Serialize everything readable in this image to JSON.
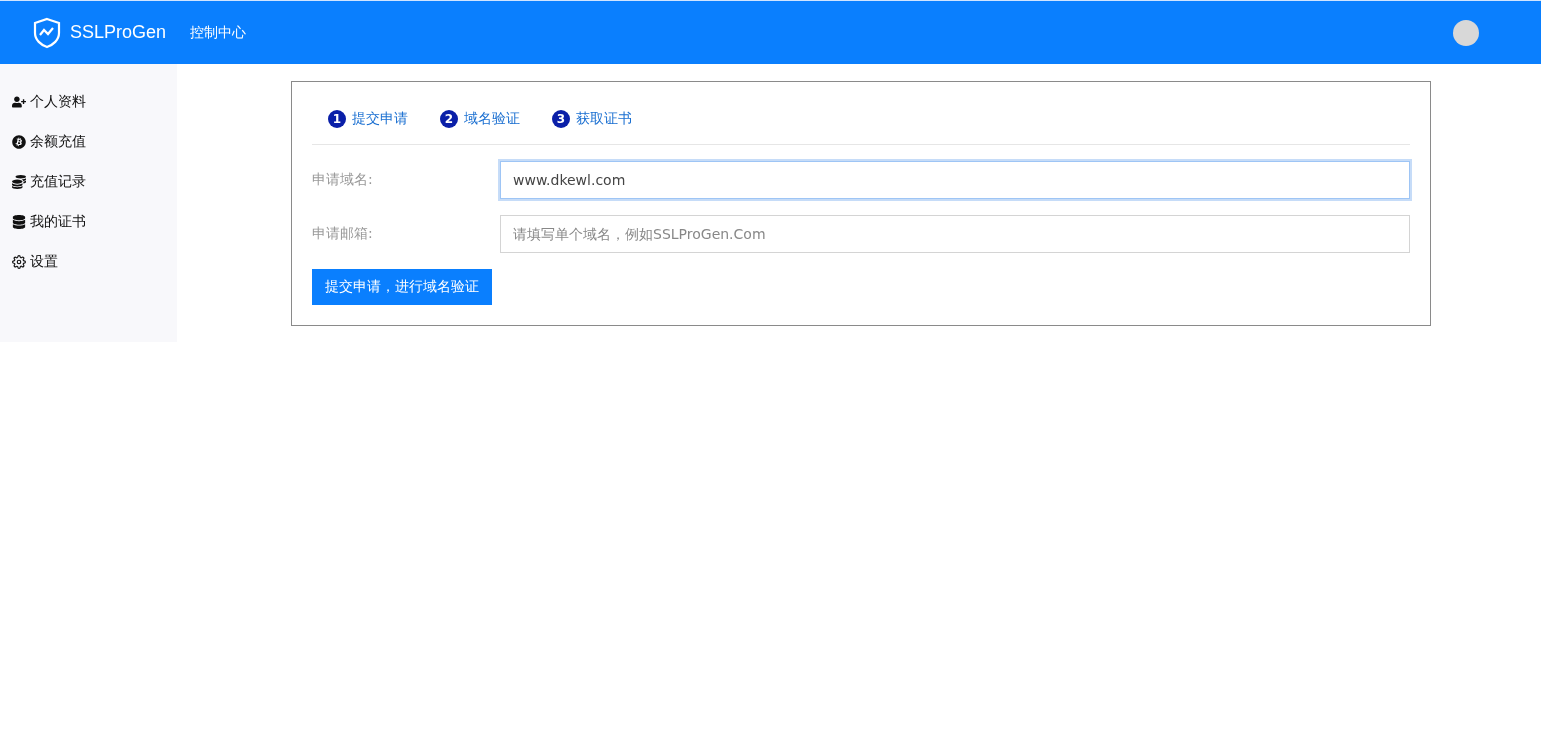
{
  "header": {
    "brand": "SSLProGen",
    "nav_link": "控制中心"
  },
  "sidebar": {
    "items": [
      {
        "label": "个人资料"
      },
      {
        "label": "余额充值"
      },
      {
        "label": "充值记录"
      },
      {
        "label": "我的证书"
      },
      {
        "label": "设置"
      }
    ]
  },
  "steps": [
    {
      "number": "1",
      "label": "提交申请"
    },
    {
      "number": "2",
      "label": "域名验证"
    },
    {
      "number": "3",
      "label": "获取证书"
    }
  ],
  "form": {
    "fields": [
      {
        "label": "申请域名:",
        "value": "www.dkewl.com",
        "focused": true
      },
      {
        "label": "申请邮箱:",
        "placeholder": "请填写单个域名，例如SSLProGen.Com",
        "focused": false
      }
    ],
    "submit": "提交申请，进行域名验证"
  }
}
